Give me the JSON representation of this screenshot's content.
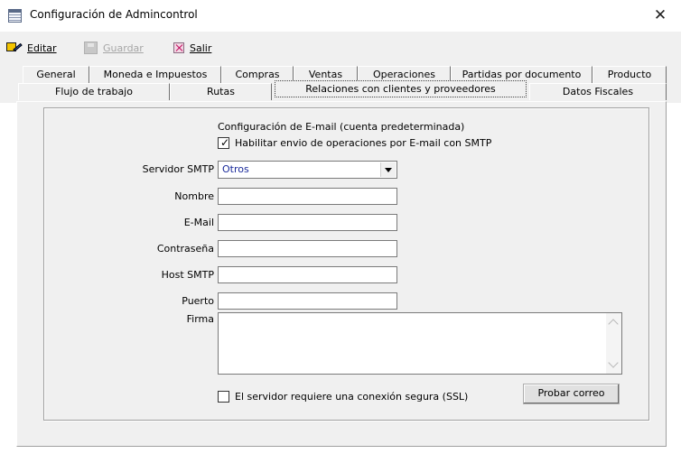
{
  "window": {
    "title": "Configuración de Admincontrol",
    "close_glyph": "✕"
  },
  "toolbar": {
    "edit_label": "Editar",
    "save_label": "Guardar",
    "exit_label": "Salir"
  },
  "tabs": {
    "row1": [
      {
        "label": "General"
      },
      {
        "label": "Moneda e Impuestos"
      },
      {
        "label": "Compras"
      },
      {
        "label": "Ventas"
      },
      {
        "label": "Operaciones"
      },
      {
        "label": "Partidas por documento"
      },
      {
        "label": "Producto"
      }
    ],
    "row2": [
      {
        "label": "Flujo de trabajo"
      },
      {
        "label": "Rutas"
      },
      {
        "label": "Relaciones con clientes y proveedores",
        "active": true
      },
      {
        "label": "Datos Fiscales"
      }
    ]
  },
  "email": {
    "section_title": "Configuración de E-mail (cuenta predeterminada)",
    "enable_label": "Habilitar envio de operaciones por  E-mail con SMTP",
    "enable_checked": true,
    "smtp_server_label": "Servidor SMTP",
    "smtp_server_value": "Otros",
    "name_label": "Nombre",
    "name_value": "",
    "email_label": "E-Mail",
    "email_value": "",
    "password_label": "Contraseña",
    "password_value": "",
    "host_label": "Host SMTP",
    "host_value": "",
    "port_label": "Puerto",
    "port_value": "",
    "signature_label": "Firma",
    "signature_value": "",
    "ssl_label": "El servidor requiere una conexión segura (SSL)",
    "ssl_checked": false,
    "test_button_label": "Probar correo"
  }
}
